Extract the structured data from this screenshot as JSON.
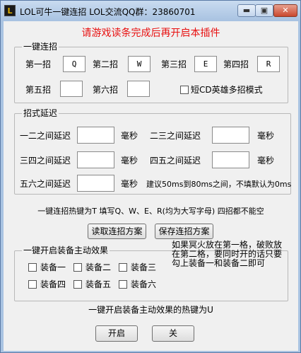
{
  "window": {
    "title": "LOL可牛一键连招 LOL交流QQ群：23860701",
    "icon_text": "L",
    "minimize_symbol": "▬",
    "maximize_symbol": "▣",
    "close_symbol": "✕"
  },
  "warning": "请游戏读条完成后再开启本插件",
  "combo": {
    "title": "一键连招",
    "moves": [
      {
        "label": "第一招",
        "key": "Q"
      },
      {
        "label": "第二招",
        "key": "W"
      },
      {
        "label": "第三招",
        "key": "E"
      },
      {
        "label": "第四招",
        "key": "R"
      },
      {
        "label": "第五招",
        "key": ""
      },
      {
        "label": "第六招",
        "key": ""
      }
    ],
    "short_cd_label": "短CD英雄多招模式"
  },
  "delay": {
    "title": "招式延迟",
    "rows": [
      {
        "label": "一二之间延迟",
        "unit": "毫秒"
      },
      {
        "label": "二三之间延迟",
        "unit": "毫秒"
      },
      {
        "label": "三四之间延迟",
        "unit": "毫秒"
      },
      {
        "label": "四五之间延迟",
        "unit": "毫秒"
      },
      {
        "label": "五六之间延迟",
        "unit": "毫秒"
      }
    ],
    "hint": "建议50ms到80ms之间，不填默认为0ms"
  },
  "hotkey_text": "一键连招热键为T 填写Q、W、E、R(均为大写字母) 四招都不能空",
  "read_button": "读取连招方案",
  "save_button": "保存连招方案",
  "equip": {
    "title": "一键开启装备主动效果",
    "items": [
      "装备一",
      "装备二",
      "装备三",
      "装备四",
      "装备五",
      "装备六"
    ],
    "note": "如果冥火放在第一格，破败放在第二格，要同时开的话只要勾上装备一和装备二即可"
  },
  "equip_hotkey_text": "一键开启装备主动效果的热键为U",
  "start_button": "开启",
  "stop_button": "关"
}
